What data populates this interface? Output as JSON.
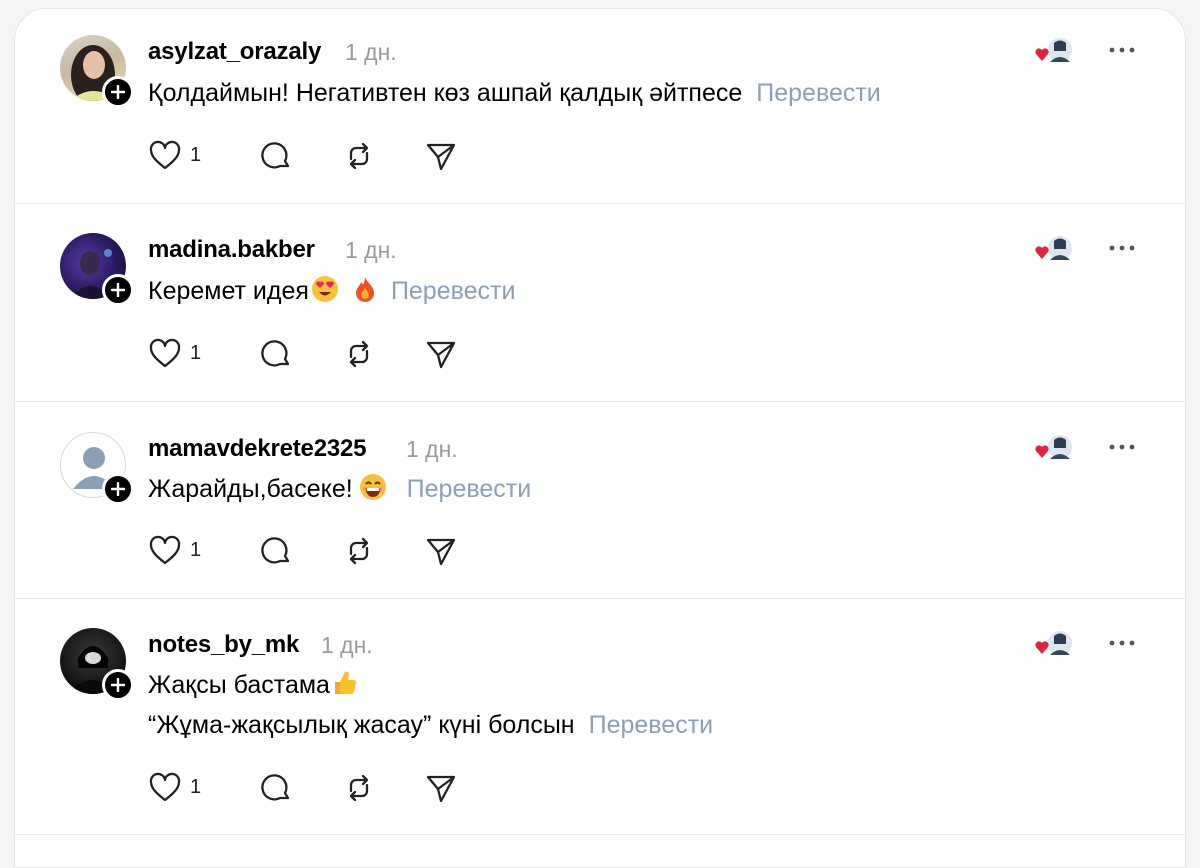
{
  "posts": [
    {
      "username": "asylzat_orazaly",
      "time": "1 дн.",
      "lines": [
        "Қолдаймын! Негативтен көз ашпай қалдық әйтпесе"
      ],
      "translate": "Перевести",
      "likes": "1",
      "avatar": "woman-photo"
    },
    {
      "username": "madina.bakber",
      "time": "1 дн.",
      "lines": [
        "Керемет идея"
      ],
      "emoji": [
        "heart-eyes-emoji",
        "fire-emoji"
      ],
      "translate": "Перевести",
      "likes": "1",
      "avatar": "dark-photo"
    },
    {
      "username": "mamavdekrete2325",
      "time": "1 дн.",
      "lines": [
        "Жарайды,басеке!"
      ],
      "emoji": [
        "grinning-emoji"
      ],
      "translate": "Перевести",
      "likes": "1",
      "avatar": "default-user"
    },
    {
      "username": "notes_by_mk",
      "time": "1 дн.",
      "lines": [
        "Жақсы бастама",
        "“Жұма-жақсылық жасау” күні болсын"
      ],
      "emoji": [
        "thumbs-up-emoji"
      ],
      "translate": "Перевести",
      "likes": "1",
      "avatar": "hooded-figure-photo"
    }
  ],
  "colors": {
    "translate": "#8ba0b8",
    "time": "#9a9a9a",
    "reaction_heart": "#e0243f"
  }
}
